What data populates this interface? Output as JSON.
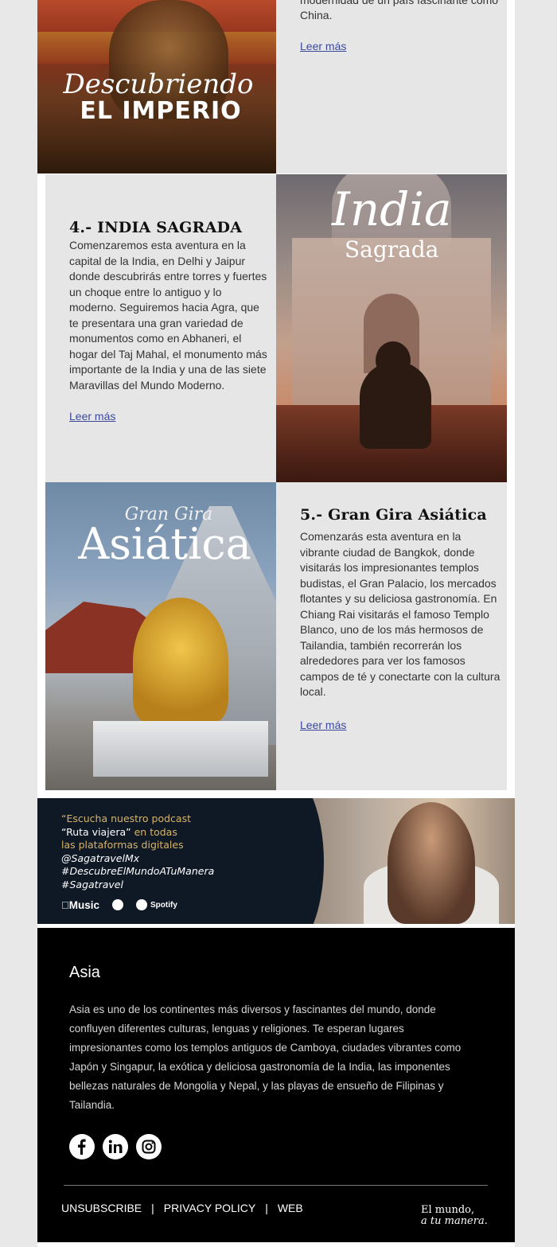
{
  "row1": {
    "image_title_script": "Descubriendo",
    "image_title_main": "EL IMPERIO",
    "text_partial_line": "modernidad de un país fascinante como",
    "text_partial_line2": "China.",
    "link": "Leer más"
  },
  "row2": {
    "heading": "4.- INDIA SAGRADA",
    "body": "Comenzaremos esta aventura en la capital de la India, en Delhi y Jaipur donde descubrirás entre torres y fuertes un choque entre lo antiguo y lo moderno. Seguiremos hacia Agra, que te presentara una gran variedad de monumentos como en Abhaneri, el hogar del Taj Mahal, el monumento más importante de la India y una de las siete Maravillas del Mundo Moderno.",
    "link": "Leer más",
    "image_title_script": "India",
    "image_title_sub": "Sagrada"
  },
  "row3": {
    "heading": "5.- Gran Gira Asiática",
    "body": "Comenzarás esta aventura en la vibrante ciudad de Bangkok, donde visitarás los impresionantes templos budistas, el Gran Palacio, los mercados flotantes y su deliciosa gastronomía. En Chiang Rai visitarás el famoso Templo Blanco, uno de los más hermosos de Tailandia, también recorrerán los alrededores para ver los famosos campos de té y conectarte con la cultura local.",
    "link": "Leer más",
    "image_title_script": "Gran Gira",
    "image_title_main": "Asiática"
  },
  "podcast": {
    "line1": "“Escucha nuestro podcast",
    "line2_title": "“Ruta viajera”",
    "line2_rest": " en todas",
    "line3": "las plataformas digitales",
    "tag1": "@SagatravelMx",
    "tag2": "#DescubreElMundoATuManera",
    "tag3": "#Sagatravel",
    "apple_music": "Music",
    "spotify": "Spotify"
  },
  "footer": {
    "title": "Asia",
    "body": "Asia es uno de los continentes más diversos y fascinantes del mundo, donde confluyen diferentes culturas, lenguas y religiones. Te esperan lugares impresionantes como los templos antiguos de Camboya, ciudades vibrantes como Japón y Singapur, la exótica y deliciosa gastronomía de la India, las imponentes bellezas naturales de Mongolia y Nepal, y las playas de ensueño de Filipinas y Tailandia.",
    "links": [
      "UNSUBSCRIBE",
      "PRIVACY POLICY",
      "WEB"
    ],
    "separator": "|",
    "slogan_line1": "El mundo,",
    "slogan_line2": "a tu manera."
  },
  "colors": {
    "panel_bg": "#e6e6e6",
    "link": "#3b4a9c",
    "footer_bg": "#000000",
    "podcast_bg": "#0f1825",
    "podcast_gold": "#d7b46a"
  }
}
